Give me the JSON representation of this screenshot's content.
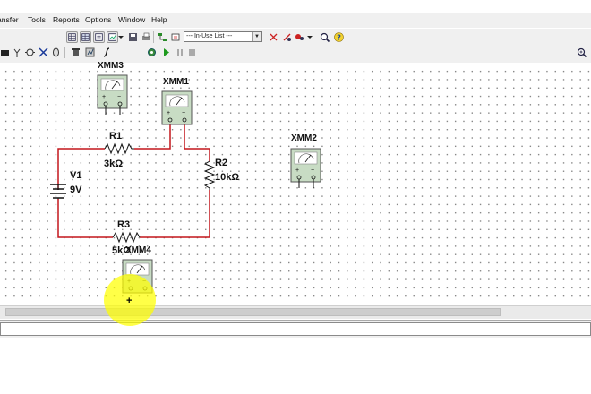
{
  "menubar": {
    "items": [
      "ansfer",
      "Tools",
      "Reports",
      "Options",
      "Window",
      "Help"
    ]
  },
  "toolbar": {
    "inuse_list": "--- In-Use List ---"
  },
  "instruments": {
    "xmm3": "XMM3",
    "xmm1": "XMM1",
    "xmm2": "XMM2",
    "xmm4": "XMM4"
  },
  "components": {
    "r1_name": "R1",
    "r1_value": "3kΩ",
    "r2_name": "R2",
    "r2_value": "10kΩ",
    "r3_name": "R3",
    "r3_value": "5kΩ",
    "v1_name": "V1",
    "v1_value": "9V"
  },
  "colors": {
    "wire": "#c4161c",
    "instrument_fill": "#c8dcc4",
    "highlight": "#ffff00"
  }
}
